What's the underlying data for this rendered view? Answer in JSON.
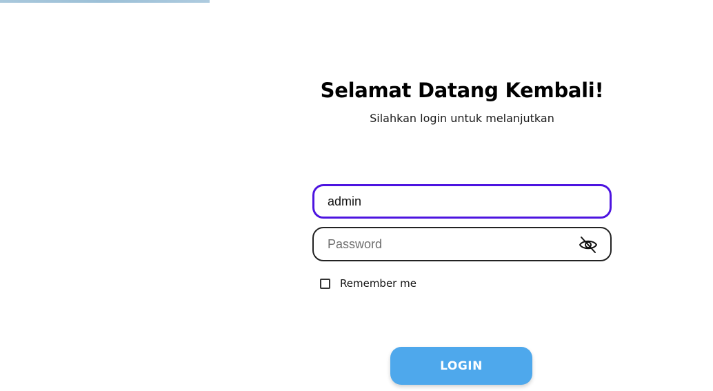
{
  "login": {
    "title": "Selamat Datang Kembali!",
    "subtitle": "Silahkan login untuk melanjutkan",
    "username": {
      "value": "admin"
    },
    "password": {
      "placeholder": "Password",
      "toggle_icon": "eye-off-icon"
    },
    "remember_me": {
      "label": "Remember me",
      "checked": false
    },
    "submit_label": "LOGIN"
  },
  "colors": {
    "accent_focus": "#4d14e0",
    "button": "#4ea8ec",
    "background": "#ffffff"
  }
}
